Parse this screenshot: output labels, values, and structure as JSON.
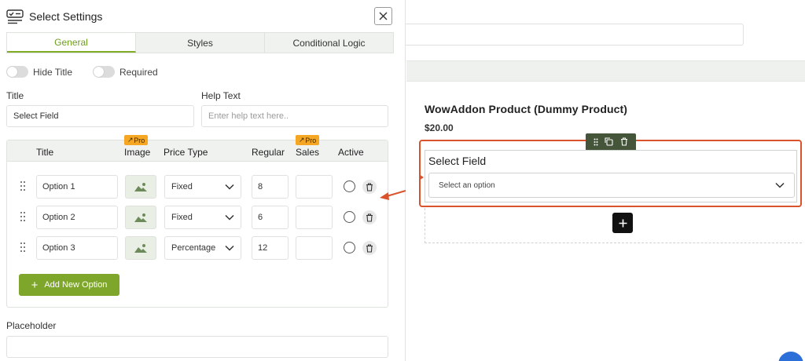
{
  "panel": {
    "title": "Select Settings",
    "header_icon": "list-checklist-icon",
    "close_icon": "close-icon"
  },
  "tabs": [
    {
      "label": "General",
      "active": true
    },
    {
      "label": "Styles",
      "active": false
    },
    {
      "label": "Conditional Logic",
      "active": false
    }
  ],
  "toggles": {
    "hide_title": "Hide Title",
    "required": "Required"
  },
  "fields": {
    "title_label": "Title",
    "title_value": "Select Field",
    "help_label": "Help Text",
    "help_placeholder": "Enter help text here..",
    "placeholder_label": "Placeholder",
    "placeholder_value": ""
  },
  "options_table": {
    "headers": {
      "title": "Title",
      "image": "Image",
      "price_type": "Price Type",
      "regular": "Regular",
      "sales": "Sales",
      "active": "Active"
    },
    "pro_badge": "Pro",
    "rows": [
      {
        "title": "Option 1",
        "price_type": "Fixed",
        "regular": "8",
        "sales": ""
      },
      {
        "title": "Option 2",
        "price_type": "Fixed",
        "regular": "6",
        "sales": ""
      },
      {
        "title": "Option 3",
        "price_type": "Percentage",
        "regular": "12",
        "sales": ""
      }
    ],
    "add_button": "Add New Option"
  },
  "preview": {
    "product_title": "WowAddon Product (Dummy Product)",
    "product_price": "$20.00",
    "field_title": "Select Field",
    "select_placeholder": "Select an option"
  },
  "colors": {
    "accent_green": "#7ea62b",
    "highlight_red": "#d9532d",
    "pro_orange": "#f5a623",
    "toolbar_dark": "#44553a"
  }
}
